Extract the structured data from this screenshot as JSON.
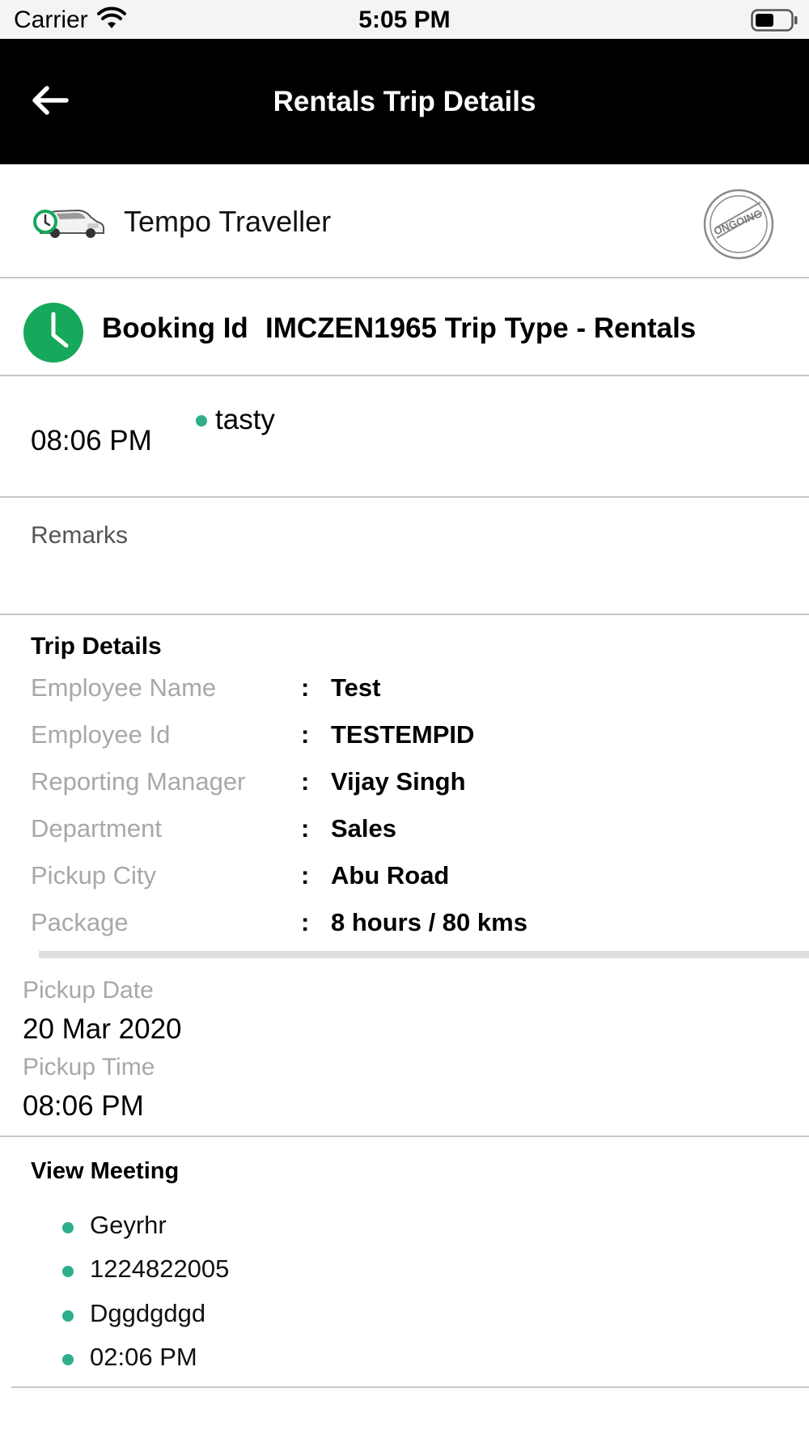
{
  "status_bar": {
    "carrier": "Carrier",
    "time": "5:05 PM"
  },
  "header": {
    "title": "Rentals Trip Details"
  },
  "vehicle": {
    "name": "Tempo Traveller",
    "status_stamp": "ONGOING"
  },
  "booking": {
    "label": "Booking Id",
    "value": "IMCZEN1965 Trip Type - Rentals"
  },
  "trip_time": {
    "time": "08:06 PM",
    "location": "tasty"
  },
  "remarks": {
    "label": "Remarks"
  },
  "trip_details": {
    "title": "Trip Details",
    "colon": ":",
    "rows": [
      {
        "label": "Employee Name",
        "value": "Test"
      },
      {
        "label": "Employee Id",
        "value": "TESTEMPID"
      },
      {
        "label": "Reporting Manager",
        "value": "Vijay Singh"
      },
      {
        "label": "Department",
        "value": "Sales"
      },
      {
        "label": "Pickup City",
        "value": "Abu Road"
      },
      {
        "label": "Package",
        "value": "8 hours / 80 kms"
      }
    ]
  },
  "pickup": {
    "date_label": "Pickup Date",
    "date_value": "20 Mar 2020",
    "time_label": "Pickup Time",
    "time_value": "08:06 PM"
  },
  "meeting": {
    "title": "View Meeting",
    "items": [
      "Geyrhr",
      "1224822005",
      "Dggdgdgd",
      "02:06 PM"
    ]
  },
  "colors": {
    "accent_green": "#16a85b",
    "bullet_teal": "#2fae8c",
    "nav_background": "#000000"
  },
  "icons": {
    "back": "arrow-left-icon",
    "vehicle": "car-with-clock-icon",
    "booking": "clock-icon",
    "stamp": "ongoing-stamp-icon"
  }
}
